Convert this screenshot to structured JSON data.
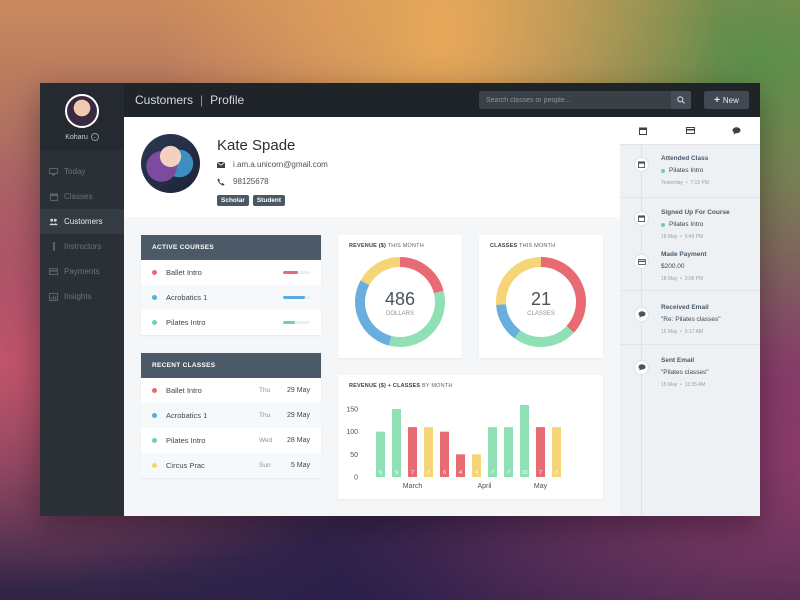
{
  "sidebar": {
    "user_name": "Koharu",
    "items": [
      {
        "label": "Today",
        "icon": "monitor-icon",
        "active": false
      },
      {
        "label": "Classes",
        "icon": "calendar-icon",
        "active": false
      },
      {
        "label": "Customers",
        "icon": "users-icon",
        "active": true
      },
      {
        "label": "Instructors",
        "icon": "instructor-icon",
        "active": false
      },
      {
        "label": "Payments",
        "icon": "credit-card-icon",
        "active": false
      },
      {
        "label": "Insights",
        "icon": "bar-chart-icon",
        "active": false
      }
    ]
  },
  "topbar": {
    "breadcrumb": {
      "section": "Customers",
      "separator": "|",
      "page": "Profile"
    },
    "search_placeholder": "Search classes or people...",
    "new_label": "New"
  },
  "profile": {
    "name": "Kate Spade",
    "email": "i.am.a.unicorn@gmail.com",
    "phone": "98125678",
    "tags": [
      "Scholar",
      "Student"
    ]
  },
  "active_courses": {
    "title": "ACTIVE COURSES",
    "rows": [
      {
        "name": "Ballet Intro",
        "color": "#e86b73",
        "progress": 0.55
      },
      {
        "name": "Acrobatics 1",
        "color": "#5aabe0",
        "progress": 0.8
      },
      {
        "name": "Pilates Intro",
        "color": "#6fd3a1",
        "progress": 0.45
      }
    ]
  },
  "recent_classes": {
    "title": "RECENT CLASSES",
    "rows": [
      {
        "name": "Ballet Intro",
        "day": "Thu",
        "date": "29 May",
        "color": "#e86b73"
      },
      {
        "name": "Acrobatics 1",
        "day": "Thu",
        "date": "29 May",
        "color": "#5aabe0"
      },
      {
        "name": "Pilates Intro",
        "day": "Wed",
        "date": "28 May",
        "color": "#6fd3a1"
      },
      {
        "name": "Circus Prac",
        "day": "Sun",
        "date": "5 May",
        "color": "#f5d575"
      }
    ]
  },
  "revenue_donut": {
    "title_bold": "REVENUE ($)",
    "title_rest": "THIS MONTH",
    "value": "486",
    "unit": "DOLLARS"
  },
  "classes_donut": {
    "title_bold": "CLASSES",
    "title_rest": "THIS MONTH",
    "value": "21",
    "unit": "CLASSES"
  },
  "bar_chart_title": {
    "bold": "REVENUE ($) + CLASSES",
    "rest": "BY MONTH"
  },
  "chart_data": [
    {
      "type": "pie",
      "title": "REVENUE ($) THIS MONTH",
      "slices": [
        {
          "color": "#e86b73",
          "value": 0.21
        },
        {
          "color": "#8fe0b4",
          "value": 0.33
        },
        {
          "color": "#6aaee0",
          "value": 0.29
        },
        {
          "color": "#f5d575",
          "value": 0.17
        }
      ]
    },
    {
      "type": "pie",
      "title": "CLASSES THIS MONTH",
      "slices": [
        {
          "color": "#e86b73",
          "value": 0.37
        },
        {
          "color": "#8fe0b4",
          "value": 0.23
        },
        {
          "color": "#6aaee0",
          "value": 0.14
        },
        {
          "color": "#f5d575",
          "value": 0.26
        }
      ]
    },
    {
      "type": "bar",
      "title": "REVENUE ($) + CLASSES BY MONTH",
      "ylim": [
        0,
        150
      ],
      "yticks": [
        0,
        50,
        100,
        150
      ],
      "month_labels": [
        "March",
        "April",
        "May"
      ],
      "bars": [
        {
          "month": "March",
          "value": 100,
          "label": "6",
          "color": "#8fe0b4"
        },
        {
          "month": "March",
          "value": 150,
          "label": "9",
          "color": "#8fe0b4"
        },
        {
          "month": "March",
          "value": 110,
          "label": "7",
          "color": "#e86b73"
        },
        {
          "month": "March",
          "value": 110,
          "label": "7",
          "color": "#f5d575"
        },
        {
          "month": "March",
          "value": 100,
          "label": "6",
          "color": "#e86b73"
        },
        {
          "month": "April",
          "value": 50,
          "label": "4",
          "color": "#e86b73"
        },
        {
          "month": "April",
          "value": 50,
          "label": "4",
          "color": "#f5d575"
        },
        {
          "month": "April",
          "value": 110,
          "label": "7",
          "color": "#8fe0b4"
        },
        {
          "month": "April",
          "value": 110,
          "label": "7",
          "color": "#8fe0b4"
        },
        {
          "month": "May",
          "value": 160,
          "label": "10",
          "color": "#8fe0b4"
        },
        {
          "month": "May",
          "value": 110,
          "label": "7",
          "color": "#e86b73"
        },
        {
          "month": "May",
          "value": 110,
          "label": "7",
          "color": "#f5d575"
        }
      ]
    }
  ],
  "right_panel": {
    "tabs": [
      "calendar-icon",
      "credit-card-icon",
      "chat-icon"
    ],
    "events": [
      {
        "title": "Attended Class",
        "detail": "Pilates Intro",
        "dot_color": "#6fd3a1",
        "date": "Yesterday",
        "time": "7:15 PM",
        "icon": "calendar-icon"
      },
      {
        "title": "Signed Up For Course",
        "detail": "Pilates Intro",
        "dot_color": "#6fd3a1",
        "date": "18 May",
        "time": "5:49 PM",
        "icon": "calendar-icon"
      },
      {
        "title": "Made Payment",
        "detail": "$200.00",
        "dot_color": "",
        "date": "18 May",
        "time": "3:05 PM",
        "icon": "credit-card-icon"
      },
      {
        "title": "Received Email",
        "detail": "\"Re: Pilates classes\"",
        "dot_color": "",
        "date": "16 May",
        "time": "9:17 AM",
        "icon": "chat-icon"
      },
      {
        "title": "Sent Email",
        "detail": "\"Pilates classes\"",
        "dot_color": "",
        "date": "15 May",
        "time": "11:35 AM",
        "icon": "chat-icon"
      }
    ]
  }
}
